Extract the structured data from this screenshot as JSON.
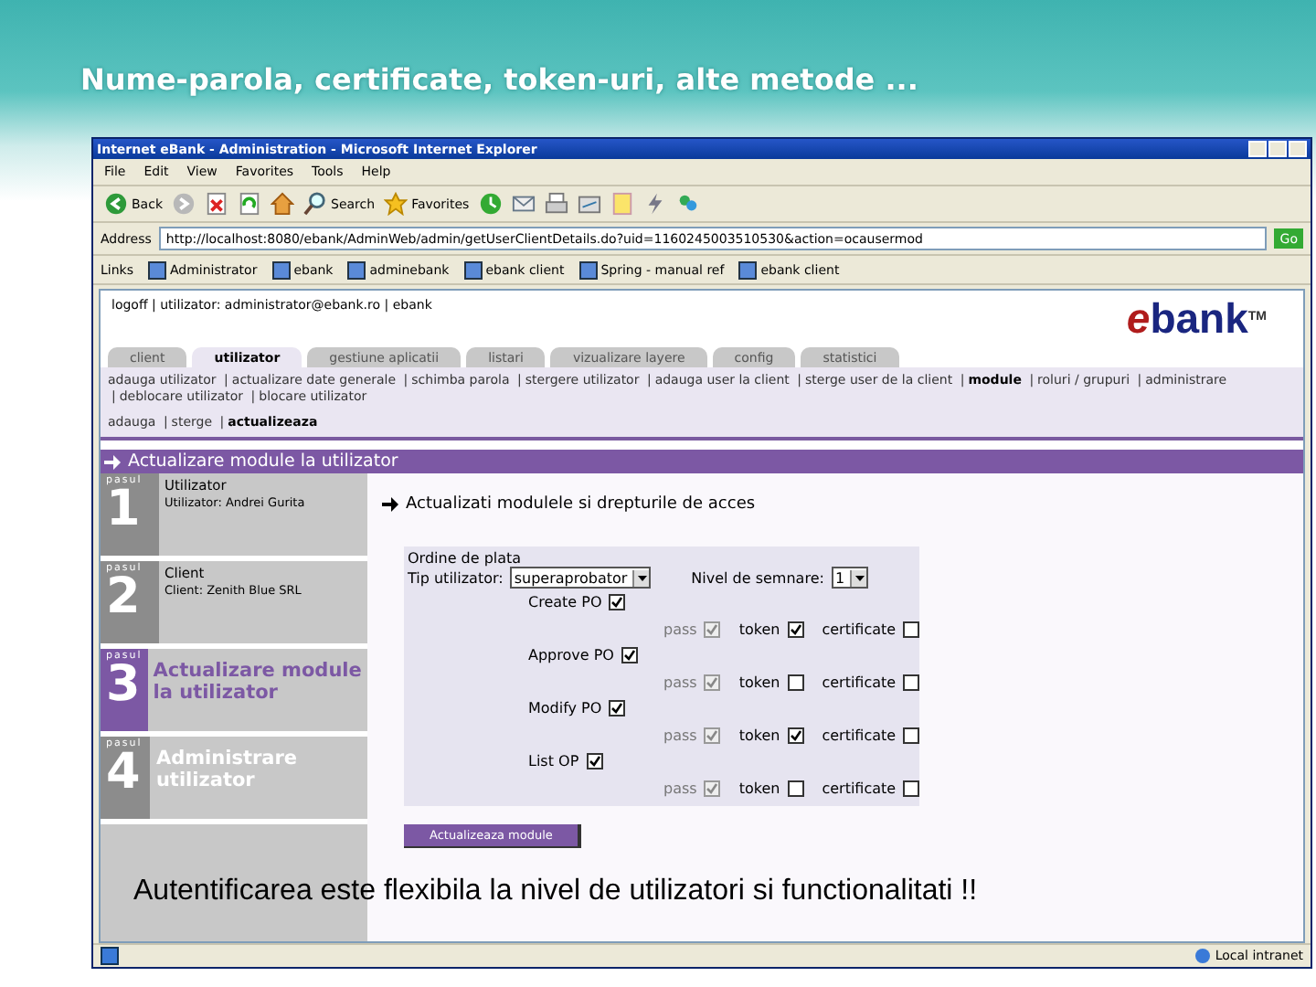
{
  "slide": {
    "title": "Nume-parola, certificate, token-uri, alte metode ...",
    "caption": "Autentificarea este flexibila la nivel de utilizatori si functionalitati !!"
  },
  "window": {
    "title": "Internet eBank - Administration - Microsoft Internet Explorer"
  },
  "menu": [
    "File",
    "Edit",
    "View",
    "Favorites",
    "Tools",
    "Help"
  ],
  "toolbar": [
    {
      "kind": "back",
      "label": "Back"
    },
    {
      "kind": "forward"
    },
    {
      "kind": "stop"
    },
    {
      "kind": "refresh"
    },
    {
      "kind": "home"
    },
    {
      "kind": "search",
      "label": "Search"
    },
    {
      "kind": "favorites",
      "label": "Favorites"
    },
    {
      "kind": "history"
    },
    {
      "kind": "mail"
    },
    {
      "kind": "print"
    },
    {
      "kind": "edit"
    },
    {
      "kind": "note"
    },
    {
      "kind": "flash"
    },
    {
      "kind": "messenger"
    }
  ],
  "address": {
    "label": "Address",
    "value": "http://localhost:8080/ebank/AdminWeb/admin/getUserClientDetails.do?uid=1160245003510530&action=ocausermod",
    "go": "Go"
  },
  "links": {
    "label": "Links",
    "items": [
      "Administrator",
      "ebank",
      "adminebank",
      "ebank client",
      "Spring - manual ref",
      "ebank client"
    ]
  },
  "page": {
    "login": "logoff | utilizator: administrator@ebank.ro | ebank",
    "logo": {
      "first": "e",
      "rest": "bank",
      "tm": "TM"
    },
    "tabs": [
      {
        "label": "client",
        "selected": false
      },
      {
        "label": "utilizator",
        "selected": true
      },
      {
        "label": "gestiune aplicatii",
        "selected": false
      },
      {
        "label": "listari",
        "selected": false
      },
      {
        "label": "vizualizare layere",
        "selected": false
      },
      {
        "label": "config",
        "selected": false
      },
      {
        "label": "statistici",
        "selected": false
      }
    ],
    "subnav": [
      {
        "label": "adauga utilizator",
        "selected": false
      },
      {
        "sep": "|",
        "label": "actualizare date generale",
        "selected": false
      },
      {
        "sep": "|",
        "label": "schimba parola",
        "selected": false
      },
      {
        "sep": "|",
        "label": "stergere utilizator",
        "selected": false
      },
      {
        "sep": "|",
        "label": "adauga user la client",
        "selected": false
      },
      {
        "sep": "|",
        "label": "sterge user de la client",
        "selected": false
      },
      {
        "sep": "|",
        "label": "module",
        "selected": true
      },
      {
        "sep": "|",
        "label": "roluri / grupuri",
        "selected": false
      },
      {
        "sep": "|",
        "label": "administrare",
        "selected": false
      },
      {
        "sep": "|",
        "label": "deblocare utilizator",
        "selected": false
      },
      {
        "sep": "|",
        "label": "blocare utilizator",
        "selected": false
      }
    ],
    "subsubnav": [
      {
        "label": "adauga",
        "selected": false
      },
      {
        "sep": "|",
        "label": "sterge",
        "selected": false
      },
      {
        "sep": "|",
        "label": "actualizeaza",
        "selected": true
      }
    ],
    "section_title": "Actualizare module la utilizator",
    "steps": [
      {
        "tag": "pasul",
        "number": "1",
        "title": "Utilizator",
        "detail": "Utilizator: Andrei Gurita",
        "selected": false
      },
      {
        "tag": "pasul",
        "number": "2",
        "title": "Client",
        "detail": "Client: Zenith Blue SRL",
        "selected": false
      },
      {
        "tag": "pasul",
        "number": "3",
        "title": "Actualizare module la utilizator",
        "selected": true
      },
      {
        "tag": "pasul",
        "number": "4",
        "title": "Administrare utilizator",
        "selected": false
      }
    ],
    "heading": "Actualizati modulele si drepturile de acces",
    "form": {
      "title": "Ordine de plata",
      "user_type_label": "Tip utilizator:",
      "user_type": "superaprobator",
      "level_label": "Nivel de semnare:",
      "level": "1",
      "modules": [
        {
          "label": "Create PO",
          "checked": true,
          "rights": [
            {
              "label": "pass",
              "checked": true,
              "disabled": true
            },
            {
              "label": "token",
              "checked": true,
              "disabled": false
            },
            {
              "label": "certificate",
              "checked": false,
              "disabled": false
            }
          ]
        },
        {
          "label": "Approve PO",
          "checked": true,
          "rights": [
            {
              "label": "pass",
              "checked": true,
              "disabled": true
            },
            {
              "label": "token",
              "checked": false,
              "disabled": false
            },
            {
              "label": "certificate",
              "checked": false,
              "disabled": false
            }
          ]
        },
        {
          "label": "Modify PO",
          "checked": true,
          "rights": [
            {
              "label": "pass",
              "checked": true,
              "disabled": true
            },
            {
              "label": "token",
              "checked": true,
              "disabled": false
            },
            {
              "label": "certificate",
              "checked": false,
              "disabled": false
            }
          ]
        },
        {
          "label": "List OP",
          "checked": true,
          "rights": [
            {
              "label": "pass",
              "checked": true,
              "disabled": true
            },
            {
              "label": "token",
              "checked": false,
              "disabled": false
            },
            {
              "label": "certificate",
              "checked": false,
              "disabled": false
            }
          ]
        }
      ],
      "submit": "Actualizeaza module"
    }
  },
  "status_bar": {
    "zone": "Local intranet"
  }
}
